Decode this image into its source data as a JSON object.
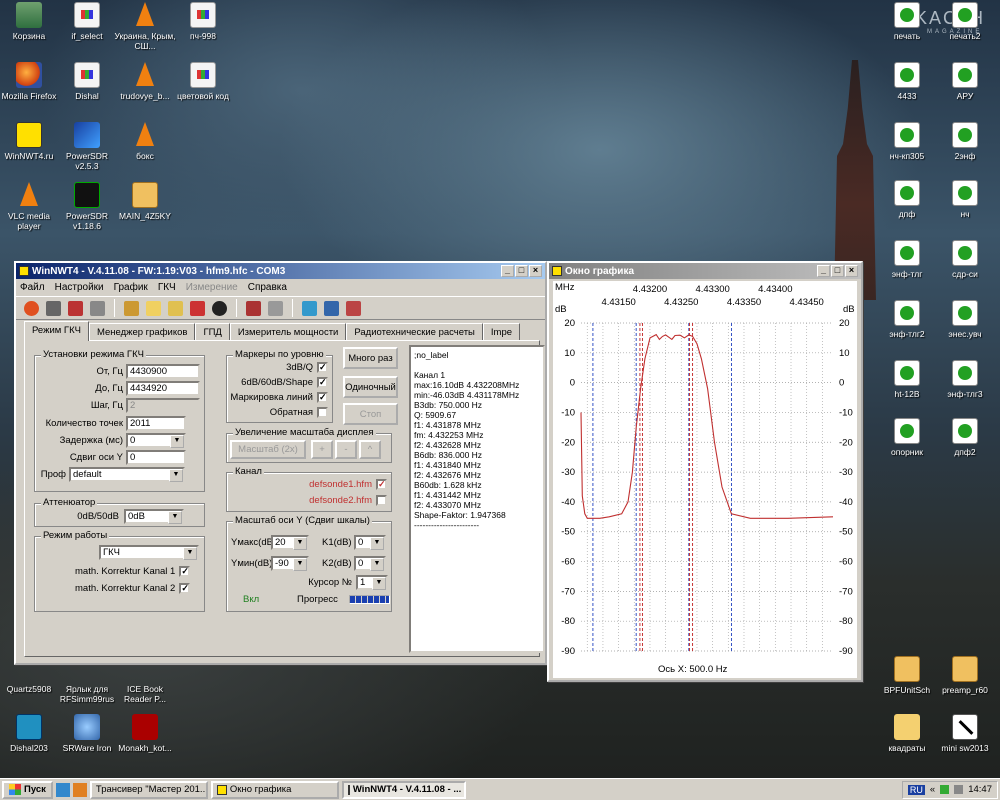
{
  "desktop": {
    "icons_left": [
      {
        "label": "Корзина",
        "icon": "recycle-bin-icon"
      },
      {
        "label": "if_select",
        "icon": "document-icon"
      },
      {
        "label": "Украина, Крым, СШ...",
        "icon": "vlc-icon"
      },
      {
        "label": "пч-998",
        "icon": "document-icon"
      },
      {
        "label": "Mozilla Firefox",
        "icon": "firefox-icon"
      },
      {
        "label": "Dishal",
        "icon": "document-icon"
      },
      {
        "label": "trudovye_b...",
        "icon": "vlc-icon"
      },
      {
        "label": "цветовой код",
        "icon": "document-icon"
      },
      {
        "label": "WinNWT4.ru",
        "icon": "winnwt-icon"
      },
      {
        "label": "PowerSDR v2.5.3",
        "icon": "powersdr-icon"
      },
      {
        "label": "бокс",
        "icon": "vlc-icon"
      },
      {
        "label": "VLC media player",
        "icon": "vlc-icon"
      },
      {
        "label": "PowerSDR v1.18.6",
        "icon": "powersdr-icon"
      },
      {
        "label": "MAIN_4Z5KY",
        "icon": "archive-icon"
      },
      {
        "label": "Quartz5908",
        "icon": "app-icon"
      },
      {
        "label": "Ярлык для RFSimm99rus",
        "icon": "app-icon"
      },
      {
        "label": "ICE Book Reader P...",
        "icon": "app-icon"
      },
      {
        "label": "Dishal203",
        "icon": "app-icon"
      },
      {
        "label": "SRWare Iron",
        "icon": "browser-icon"
      },
      {
        "label": "Monakh_kot...",
        "icon": "app-icon"
      }
    ],
    "icons_right": [
      {
        "label": "печать"
      },
      {
        "label": "печать2"
      },
      {
        "label": "4433"
      },
      {
        "label": "АРУ"
      },
      {
        "label": "нч-кп305"
      },
      {
        "label": "2энф"
      },
      {
        "label": "дпф"
      },
      {
        "label": "нч"
      },
      {
        "label": "энф-тлг"
      },
      {
        "label": "сдр-си"
      },
      {
        "label": "энф-тлг2"
      },
      {
        "label": "энес.увч"
      },
      {
        "label": "ht-12B"
      },
      {
        "label": "энф-тлг3"
      },
      {
        "label": "опорник"
      },
      {
        "label": "дпф2"
      },
      {
        "label": "BPFUnitSch"
      },
      {
        "label": "preamp_r60"
      },
      {
        "label": "квадраты"
      },
      {
        "label": "mini sw2013"
      }
    ],
    "watermark": "KACнH",
    "watermark_sub": "MAGAZINE"
  },
  "main_window": {
    "title": "WinNWT4 - V.4.11.08 - FW:1.19:V03 - hfm9.hfc - COM3",
    "menu": [
      "Файл",
      "Настройки",
      "График",
      "ГКЧ",
      "Измерение",
      "Справка"
    ],
    "tabs": [
      "Режим ГКЧ",
      "Менеджер графиков",
      "ГПД",
      "Измеритель мощности",
      "Радиотехнические расчеты",
      "Impe"
    ],
    "gkch": {
      "title": "Установки режима ГКЧ",
      "from_label": "От, Гц",
      "from_value": "4430900",
      "to_label": "До, Гц",
      "to_value": "4434920",
      "step_label": "Шаг, Гц",
      "step_value": "2",
      "points_label": "Количество точек",
      "points_value": "2011",
      "delay_label": "Задержка (мс)",
      "delay_value": "0",
      "yshift_label": "Сдвиг оси Y",
      "yshift_value": "0",
      "profile_label": "Проф",
      "profile_value": "default"
    },
    "attenuator": {
      "title": "Аттенюатор",
      "label": "0dB/50dB",
      "value": "0dB"
    },
    "mode": {
      "title": "Режим работы",
      "value": "ГКЧ",
      "korr1": "math. Korrektur Kanal 1",
      "korr2": "math. Korrektur Kanal 2"
    },
    "markers": {
      "title": "Маркеры по уровню",
      "m1": "3dB/Q",
      "m2": "6dB/60dB/Shape",
      "m3": "Маркировка линий",
      "m4": "Обратная"
    },
    "buttons": {
      "multi": "Много раз",
      "single": "Одиночный",
      "stop": "Стоп"
    },
    "zoom": {
      "title": "Увеличение масштаба дисплея",
      "label": "Масштаб (2x)",
      "plus": "+",
      "minus": "-",
      "up": "^"
    },
    "channel": {
      "title": "Канал",
      "file1": "defsonde1.hfm",
      "file2": "defsonde2.hfm"
    },
    "yscale": {
      "title": "Масштаб оси Y (Сдвиг шкалы)",
      "ymax_label": "Yмакс(dB)",
      "ymax_value": "20",
      "ymin_label": "Yмин(dB)",
      "ymin_value": "-90",
      "k1_label": "K1(dB)",
      "k1_value": "0",
      "k2_label": "K2(dB)",
      "k2_value": "0",
      "cursor_label": "Курсор №",
      "cursor_value": "1",
      "on_label": "Вкл",
      "progress_label": "Прогресс"
    },
    "output_lines": [
      ";no_label",
      "",
      "Канал 1",
      "max:16.10dB 4.432208MHz",
      "min:-46.03dB 4.431178MHz",
      "B3db: 750.000 Hz",
      "Q: 5909.67",
      "f1: 4.431878 MHz",
      "fm: 4.432253 MHz",
      "f2: 4.432628 MHz",
      "B6db: 836.000 Hz",
      "f1: 4.431840 MHz",
      "f2: 4.432676 MHz",
      "B60db: 1.628 kHz",
      "f1: 4.431442 MHz",
      "f2: 4.433070 MHz",
      "Shape-Faktor: 1.947368",
      "-----------------------"
    ]
  },
  "graph_window": {
    "title": "Окно графика",
    "x_unit": "MHz",
    "x_ticks_top": [
      "4.43200",
      "4.43300",
      "4.43400"
    ],
    "x_ticks_bottom": [
      "4.43150",
      "4.43250",
      "4.43350",
      "4.43450"
    ],
    "y_unit": "dB",
    "x_axis_label": "Ось X: 500.0 Hz"
  },
  "chart_data": {
    "type": "line",
    "x_unit": "MHz",
    "y_unit": "dB",
    "ylim": [
      -90,
      20
    ],
    "xlim": [
      4.4309,
      4.43492
    ],
    "y_ticks": [
      "20",
      "10",
      "0",
      "-10",
      "-20",
      "-30",
      "-40",
      "-50",
      "-60",
      "-70",
      "-80",
      "-90"
    ],
    "series": [
      {
        "color": "#c03030",
        "x": [
          4.4309,
          4.43092,
          4.43096,
          4.431,
          4.4312,
          4.43135,
          4.43155,
          4.43165,
          4.43172,
          4.43178,
          4.43185,
          4.43192,
          4.432,
          4.4321,
          4.43215,
          4.4322,
          4.43225,
          4.43235,
          4.4324,
          4.43248,
          4.43255,
          4.43262,
          4.43268,
          4.43275,
          4.43282,
          4.43292,
          4.43303,
          4.43315,
          4.4333,
          4.4336,
          4.4342,
          4.43492
        ],
        "y": [
          -10,
          -38,
          -44,
          -45.5,
          -45.5,
          -45,
          -44,
          -40,
          -30,
          -15,
          -2,
          8,
          15,
          16.1,
          14.5,
          15.5,
          16,
          14.5,
          15.8,
          15.9,
          15,
          16,
          15.5,
          13,
          8,
          -2,
          -20,
          -35,
          -44,
          -45.5,
          -45.5,
          -45
        ]
      }
    ],
    "markers_blue_x": [
      4.43109,
      4.43178,
      4.43262,
      4.4333
    ],
    "markers_red_x": [
      4.43184,
      4.43188,
      4.43263,
      4.43268
    ]
  },
  "taskbar": {
    "start": "Пуск",
    "tasks": [
      "Трансивер \"Мастер 201...",
      "Окно графика",
      "WinNWT4 - V.4.11.08 - ..."
    ],
    "lang": "RU",
    "time": "14:47"
  }
}
